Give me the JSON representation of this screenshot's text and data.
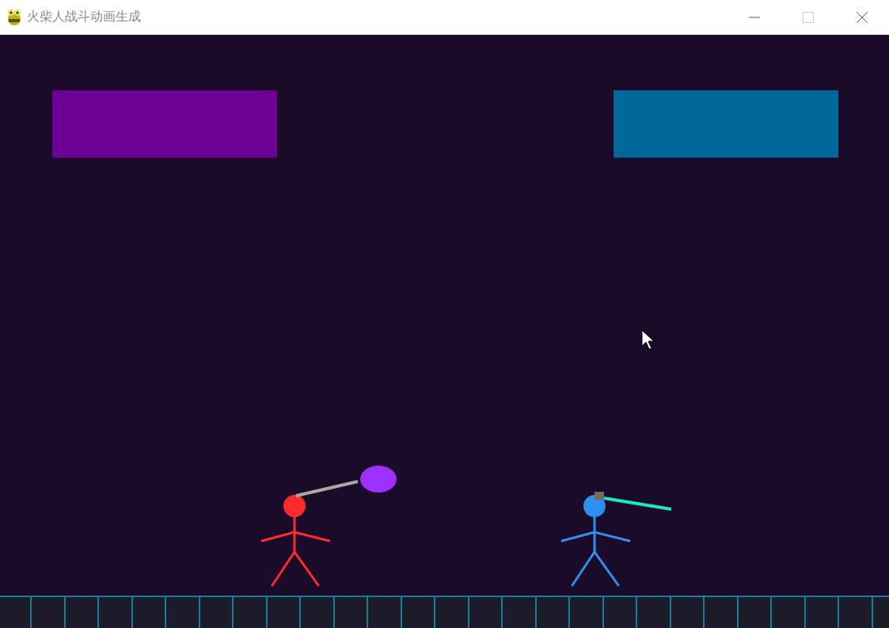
{
  "window": {
    "title": "火柴人战斗动画生成",
    "controls": [
      {
        "kind": "minimize",
        "disabled": false
      },
      {
        "kind": "maximize",
        "disabled": true
      },
      {
        "kind": "close",
        "disabled": false
      }
    ]
  },
  "health_bars": [
    {
      "color": "#6a0094"
    },
    {
      "color": "#00679a"
    }
  ],
  "fighters": [
    {
      "color": "#ff2a2a",
      "kind": "mace"
    },
    {
      "color": "#2e8ff0",
      "kind": "sword"
    }
  ]
}
